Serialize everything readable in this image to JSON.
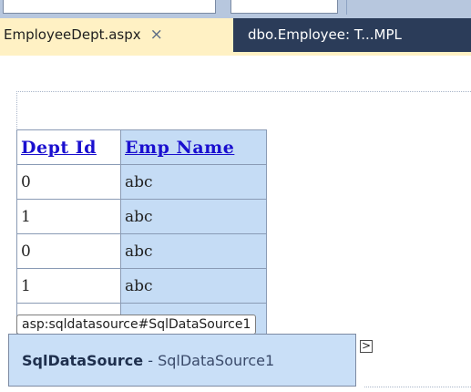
{
  "tabs": [
    {
      "label": "EmployeeDept.aspx",
      "active": true,
      "close": "×"
    },
    {
      "label": "dbo.Employee: T...MPL",
      "active": false
    }
  ],
  "grid": {
    "headers": [
      "Dept Id",
      "Emp Name"
    ],
    "rows": [
      [
        "0",
        "abc"
      ],
      [
        "1",
        "abc"
      ],
      [
        "0",
        "abc"
      ],
      [
        "1",
        "abc"
      ]
    ]
  },
  "datasource": {
    "tag": "asp:sqldatasource#SqlDataSource1",
    "type": "SqlDataSource",
    "separator": " - ",
    "name": "SqlDataSource1",
    "smart_tag": ">"
  }
}
